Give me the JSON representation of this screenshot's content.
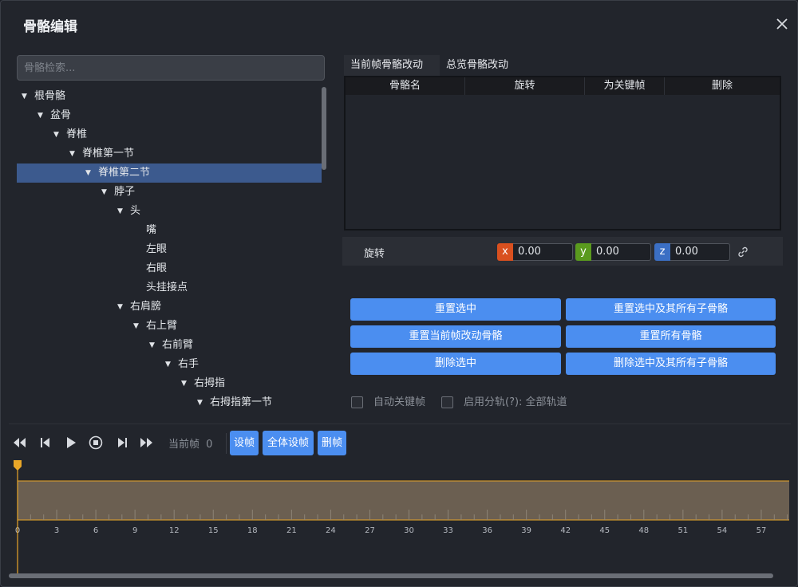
{
  "dialog": {
    "title": "骨骼编辑"
  },
  "search": {
    "placeholder": "骨骼检索..."
  },
  "tree": {
    "nodes": [
      {
        "label": "根骨骼",
        "expanded": true,
        "selected": false
      },
      {
        "label": "盆骨",
        "expanded": true,
        "selected": false
      },
      {
        "label": "脊椎",
        "expanded": true,
        "selected": false
      },
      {
        "label": "脊椎第一节",
        "expanded": true,
        "selected": false
      },
      {
        "label": "脊椎第二节",
        "expanded": true,
        "selected": true
      },
      {
        "label": "脖子",
        "expanded": true,
        "selected": false
      },
      {
        "label": "头",
        "expanded": true,
        "selected": false
      },
      {
        "label": "嘴",
        "expanded": false,
        "selected": false
      },
      {
        "label": "左眼",
        "expanded": false,
        "selected": false
      },
      {
        "label": "右眼",
        "expanded": false,
        "selected": false
      },
      {
        "label": "头挂接点",
        "expanded": false,
        "selected": false
      },
      {
        "label": "右肩膀",
        "expanded": true,
        "selected": false
      },
      {
        "label": "右上臂",
        "expanded": true,
        "selected": false
      },
      {
        "label": "右前臂",
        "expanded": true,
        "selected": false
      },
      {
        "label": "右手",
        "expanded": true,
        "selected": false
      },
      {
        "label": "右拇指",
        "expanded": true,
        "selected": false
      },
      {
        "label": "右拇指第一节",
        "expanded": true,
        "selected": false
      }
    ]
  },
  "tabs": [
    {
      "label": "当前帧骨骼改动",
      "active": false
    },
    {
      "label": "总览骨骼改动",
      "active": true
    }
  ],
  "table": {
    "headers": [
      "骨骼名",
      "旋转",
      "为关键帧",
      "删除"
    ],
    "rows": []
  },
  "rotation": {
    "label": "旋转",
    "x": {
      "tag": "x",
      "value": "0.00",
      "color": "#d9501f"
    },
    "y": {
      "tag": "y",
      "value": "0.00",
      "color": "#5a9a1e"
    },
    "z": {
      "tag": "z",
      "value": "0.00",
      "color": "#3b6fc4"
    }
  },
  "buttons": {
    "reset_selected": "重置选中",
    "reset_selected_children": "重置选中及其所有子骨骼",
    "reset_current_frame": "重置当前帧改动骨骼",
    "reset_all": "重置所有骨骼",
    "delete_selected": "删除选中",
    "delete_selected_children": "删除选中及其所有子骨骼"
  },
  "options": {
    "auto_keyframe": {
      "label": "自动关键帧",
      "checked": false
    },
    "split_track": {
      "label": "启用分轨(?): 全部轨道",
      "checked": false
    }
  },
  "transport": {
    "current_frame_label": "当前帧",
    "current_frame_value": "0",
    "set_frame": "设帧",
    "set_all_frames": "全体设帧",
    "delete_frame": "删帧"
  },
  "timeline": {
    "ticks": [
      "0",
      "3",
      "6",
      "9",
      "12",
      "15",
      "18",
      "21",
      "24",
      "27",
      "30",
      "33",
      "36",
      "39",
      "42",
      "45",
      "48",
      "51",
      "54",
      "57"
    ],
    "playhead_frame": 0,
    "accent": "#e8a628",
    "track_fill": "#6b5f51"
  },
  "colors": {
    "accent_button": "#4b8ef0",
    "selection": "#3c5a8e"
  }
}
